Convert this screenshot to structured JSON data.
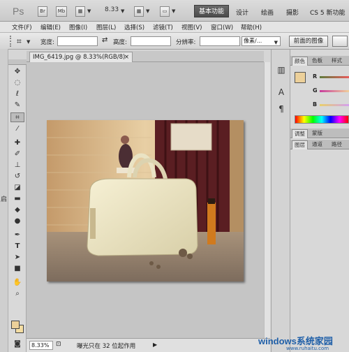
{
  "appbar": {
    "logo": "Ps",
    "bridge_btn": "Br",
    "minibridge_btn": "Mb",
    "zoom_value": "8.33",
    "workspaces": [
      "基本功能",
      "设计",
      "绘画",
      "摄影",
      "CS 5 新功能"
    ]
  },
  "menu": [
    "文件(F)",
    "编辑(E)",
    "图像(I)",
    "图层(L)",
    "选择(S)",
    "滤镜(T)",
    "视图(V)",
    "窗口(W)",
    "帮助(H)"
  ],
  "options": {
    "width_label": "宽度:",
    "height_label": "高度:",
    "resolution_label": "分辨率:",
    "unit_value": "像素/...",
    "front_image_btn": "前面的图像"
  },
  "document": {
    "tab_title": "IMG_6419.jpg @ 8.33%(RGB/8)",
    "status_zoom": "8.33%",
    "status_text": "曝光只在 32 位起作用"
  },
  "panels": {
    "color_tabs": [
      "颜色",
      "色板",
      "样式"
    ],
    "channels": [
      "R",
      "G",
      "B"
    ],
    "adjust_tabs": [
      "调整",
      "蒙版"
    ],
    "layer_tabs": [
      "图层",
      "通道",
      "路径"
    ]
  },
  "colors": {
    "foreground": "#ecd09a",
    "background": "#f4dda3",
    "workspace_active": "#555555"
  },
  "left_edge_text": "启",
  "watermark": {
    "brand": "windows系统家园",
    "url": "www.ruhaitu.com"
  }
}
